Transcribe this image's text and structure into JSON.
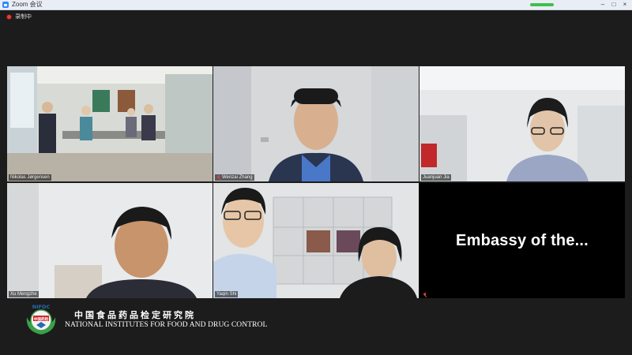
{
  "window": {
    "title": "Zoom 会议"
  },
  "recording": {
    "label": "录制中"
  },
  "participants": [
    {
      "name": "Nikolas Jørgensen",
      "active_speaker": true,
      "muted": false
    },
    {
      "name": "Wenzai Zhang",
      "active_speaker": false,
      "muted": true
    },
    {
      "name": "Juanjuan Jia",
      "active_speaker": false,
      "muted": false
    },
    {
      "name": "Xu Mengzhe",
      "active_speaker": false,
      "muted": false
    },
    {
      "name": "Yaqin Shi",
      "active_speaker": false,
      "muted": false
    },
    {
      "name": "Embassy of the...",
      "active_speaker": false,
      "muted": true,
      "video_off": true
    }
  ],
  "logo": {
    "emblem_text": "NIFDC",
    "emblem_subtext": "中国药检",
    "chinese_name": "中国食品药品检定研究院",
    "english_name": "NATIONAL INSTITUTES FOR FOOD AND DRUG CONTROL"
  },
  "colors": {
    "active_speaker_border": "#d9e84a",
    "background": "#1c1c1c",
    "muted_icon": "#e04040"
  }
}
